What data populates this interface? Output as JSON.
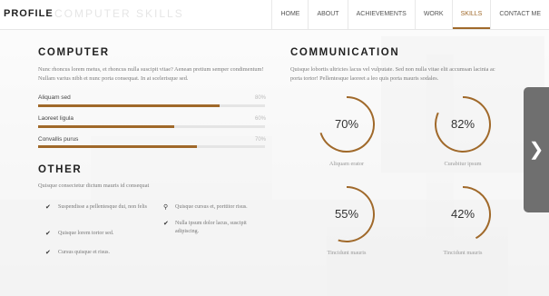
{
  "nav": {
    "brand": "PROFILE",
    "ghost_title": "COMPUTER SKILLS",
    "items": [
      "HOME",
      "ABOUT",
      "ACHIEVEMENTS",
      "WORK",
      "SKILLS",
      "CONTACT ME"
    ],
    "active": "SKILLS"
  },
  "computer": {
    "title": "COMPUTER",
    "text": "Nunc rhoncus lorem metus, et rhoncus nulla suscipit vitae? Aenean pretium semper condimentum! Nullam varius nibh et nunc porta consequat. In at scelerisque sed.",
    "bars": [
      {
        "label": "Aliquam sed",
        "value": 80,
        "pct": "80%"
      },
      {
        "label": "Laoreet ligula",
        "value": 60,
        "pct": "60%"
      },
      {
        "label": "Convallis purus",
        "value": 70,
        "pct": "70%"
      }
    ]
  },
  "other": {
    "title": "OTHER",
    "text": "Quisque consectetur dictum mauris id consequat",
    "items_left": [
      "Suspendisse a pellentesque dui, non felis",
      "Quisque lorem tortor sed.",
      "Cursus quisque et risus."
    ],
    "items_right": [
      "Quisque cursus et, porttitor risus.",
      "Nulla ipsum dolor lacus, suscipit adipiscing."
    ]
  },
  "communication": {
    "title": "COMMUNICATION",
    "text": "Quisque lobortis ultricies lacus vel vulputate. Sed non nulla vitae elit accumsan lacinia ac porta tortor! Pellentesque laoreet a leo quis porta mauris sodales.",
    "circles": [
      {
        "value": 70,
        "label_val": "70%",
        "caption": "Aliquam erator"
      },
      {
        "value": 82,
        "label_val": "82%",
        "caption": "Curabitur ipsum"
      },
      {
        "value": 55,
        "label_val": "55%",
        "caption": "Tincidunt mauris"
      },
      {
        "value": 42,
        "label_val": "42%",
        "caption": "Tincidunt mauris"
      }
    ]
  },
  "accent": "#a0692a",
  "next_icon": "chevron-right-icon",
  "next_glyph": "❯"
}
